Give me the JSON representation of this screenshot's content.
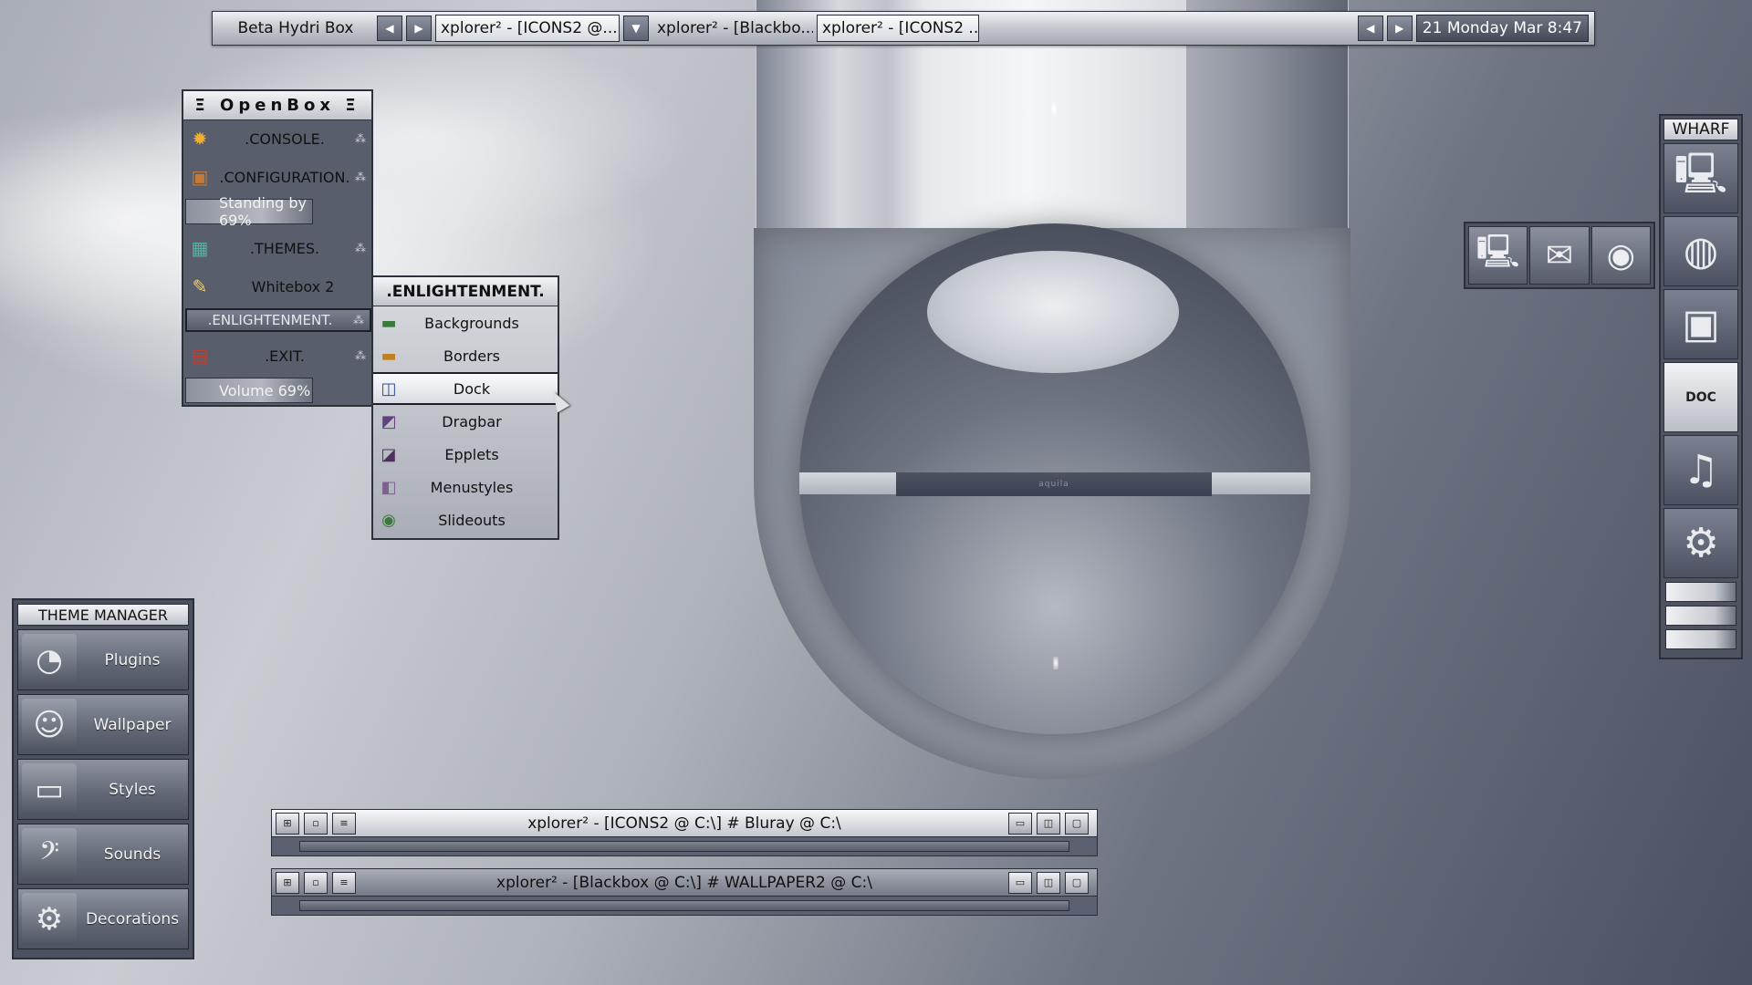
{
  "taskbar": {
    "title": "Beta Hydri Box",
    "tasks": [
      "xplorer² - [ICONS2 @...",
      "xplorer² - [Blackbo...",
      "xplorer² - [ICONS2 ..."
    ],
    "clock": "21 Monday Mar 8:47",
    "prev_icon": "arrow-left-icon",
    "next_icon": "arrow-right-icon",
    "menu_icon": "arrow-down-icon"
  },
  "openbox": {
    "title": "Ξ OpenBox Ξ",
    "items": [
      {
        "label": ".CONSOLE.",
        "icon": "gear-icon",
        "submenu_marker": "⁂"
      },
      {
        "label": ".CONFIGURATION.",
        "icon": "box-icon",
        "submenu_marker": "⁂"
      },
      {
        "label": "Standing by 69%",
        "icon": "person-icon"
      },
      {
        "label": ".THEMES.",
        "icon": "themes-icon",
        "submenu_marker": "⁂"
      },
      {
        "label": "Whitebox 2",
        "icon": "paint-icon"
      },
      {
        "label": ".ENLIGHTENMENT.",
        "icon": "",
        "submenu_marker": "⁂"
      },
      {
        "label": ".EXIT.",
        "icon": "exit-icon",
        "submenu_marker": "⁂"
      },
      {
        "label": "Volume 69%",
        "icon": "volume-person-icon"
      }
    ],
    "standby_level": 0.69,
    "volume_level": 0.69
  },
  "enlightenment": {
    "title": ".ENLIGHTENMENT.",
    "items": [
      {
        "label": "Backgrounds",
        "icon": "folder-icon"
      },
      {
        "label": "Borders",
        "icon": "folder-icon"
      },
      {
        "label": "Dock",
        "icon": "dock-icon"
      },
      {
        "label": "Dragbar",
        "icon": "book-icon"
      },
      {
        "label": "Epplets",
        "icon": "epplets-icon"
      },
      {
        "label": "Menustyles",
        "icon": "document-icon"
      },
      {
        "label": "Slideouts",
        "icon": "slideouts-icon"
      }
    ],
    "hovered": "Dock"
  },
  "theme_manager": {
    "title": "THEME MANAGER",
    "buttons": [
      {
        "label": "Plugins",
        "icon": "gauge-icon"
      },
      {
        "label": "Wallpaper",
        "icon": "finder-face-icon"
      },
      {
        "label": "Styles",
        "icon": "monitor-icon"
      },
      {
        "label": "Sounds",
        "icon": "bass-clef-icon"
      },
      {
        "label": "Decorations",
        "icon": "gear-icon"
      }
    ]
  },
  "windows": [
    {
      "title": "xplorer² - [ICONS2 @ C:\\] # Bluray @ C:\\",
      "active": true
    },
    {
      "title": "xplorer² - [Blackbox @ C:\\] # WALLPAPER2 @ C:\\",
      "active": false
    }
  ],
  "wharf": {
    "title": "WHARF",
    "icons": [
      "computer-icon",
      "globe-icon",
      "network-icon",
      "doc-icon",
      "music-cd-icon",
      "settings-icon"
    ],
    "doc_label": "DOC"
  },
  "dock": {
    "icons": [
      "computer-network-icon",
      "mail-icon",
      "speaker-icon"
    ]
  },
  "desktop": {
    "art_label": "aquila"
  }
}
